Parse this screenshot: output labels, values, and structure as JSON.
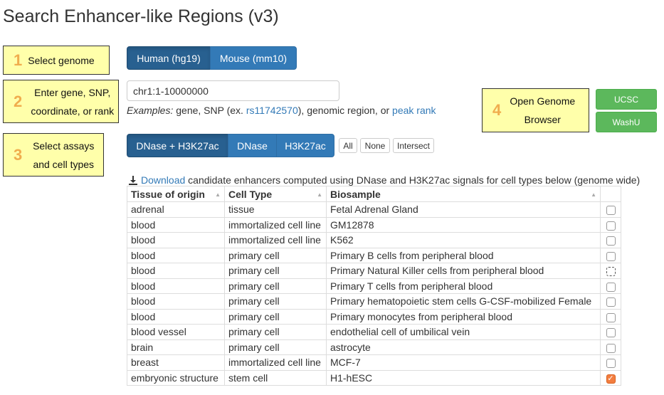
{
  "page_title": "Search Enhancer-like Regions (v3)",
  "steps": [
    {
      "num": "1",
      "text": "Select genome"
    },
    {
      "num": "2",
      "text": "Enter gene, SNP, coordinate, or rank"
    },
    {
      "num": "3",
      "text": "Select assays and cell types"
    },
    {
      "num": "4",
      "text": "Open Genome Browser"
    }
  ],
  "genome": {
    "options": [
      "Human (hg19)",
      "Mouse (mm10)"
    ],
    "selected": "Human (hg19)"
  },
  "search": {
    "value": "chr1:1-10000000",
    "examples_prefix": "Examples:",
    "examples_mid1": " gene, SNP (ex. ",
    "examples_snp": "rs11742570",
    "examples_mid2": "), genomic region, or ",
    "examples_peak": "peak rank"
  },
  "assays": {
    "options": [
      "DNase + H3K27ac",
      "DNase",
      "H3K27ac"
    ],
    "selected": "DNase + H3K27ac"
  },
  "select_buttons": [
    "All",
    "None",
    "Intersect"
  ],
  "browser_buttons": [
    "UCSC",
    "WashU"
  ],
  "download": {
    "link": "Download",
    "text": " candidate enhancers computed using DNase and H3K27ac signals for cell types below (genome wide)"
  },
  "table": {
    "headers": [
      "Tissue of origin",
      "Cell Type",
      "Biosample"
    ],
    "rows": [
      {
        "tissue": "adrenal",
        "cell_type": "tissue",
        "biosample": "Fetal Adrenal Gland",
        "checked": false
      },
      {
        "tissue": "blood",
        "cell_type": "immortalized cell line",
        "biosample": "GM12878",
        "checked": false
      },
      {
        "tissue": "blood",
        "cell_type": "immortalized cell line",
        "biosample": "K562",
        "checked": false
      },
      {
        "tissue": "blood",
        "cell_type": "primary cell",
        "biosample": "Primary B cells from peripheral blood",
        "checked": false
      },
      {
        "tissue": "blood",
        "cell_type": "primary cell",
        "biosample": "Primary Natural Killer cells from peripheral blood",
        "checked": false,
        "focused": true
      },
      {
        "tissue": "blood",
        "cell_type": "primary cell",
        "biosample": "Primary T cells from peripheral blood",
        "checked": false
      },
      {
        "tissue": "blood",
        "cell_type": "primary cell",
        "biosample": "Primary hematopoietic stem cells G-CSF-mobilized Female",
        "checked": false
      },
      {
        "tissue": "blood",
        "cell_type": "primary cell",
        "biosample": "Primary monocytes from peripheral blood",
        "checked": false
      },
      {
        "tissue": "blood vessel",
        "cell_type": "primary cell",
        "biosample": "endothelial cell of umbilical vein",
        "checked": false
      },
      {
        "tissue": "brain",
        "cell_type": "primary cell",
        "biosample": "astrocyte",
        "checked": false
      },
      {
        "tissue": "breast",
        "cell_type": "immortalized cell line",
        "biosample": "MCF-7",
        "checked": false
      },
      {
        "tissue": "embryonic structure",
        "cell_type": "stem cell",
        "biosample": "H1-hESC",
        "checked": true
      }
    ]
  },
  "icons": {
    "download": "download-icon",
    "sort": "sort-icon",
    "check": "checkmark-icon"
  }
}
